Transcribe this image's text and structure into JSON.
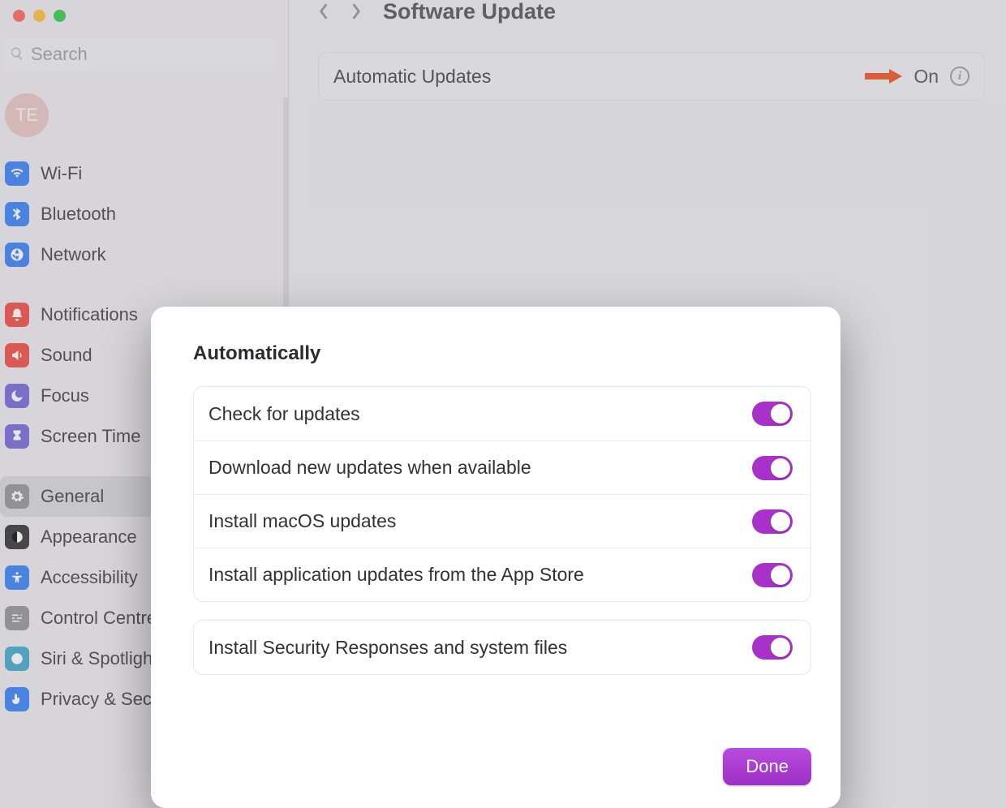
{
  "colors": {
    "accent": "#a832c9",
    "annotation_arrow": "#f24a19"
  },
  "window": {
    "title": "Software Update"
  },
  "search": {
    "placeholder": "Search"
  },
  "user": {
    "initials": "TE"
  },
  "sidebar": {
    "items": [
      {
        "label": "Wi-Fi",
        "color": "#2f7bf6",
        "icon": "wifi"
      },
      {
        "label": "Bluetooth",
        "color": "#2f7bf6",
        "icon": "bluetooth"
      },
      {
        "label": "Network",
        "color": "#2f7bf6",
        "icon": "globe"
      },
      {
        "label": "Notifications",
        "color": "#f2453d",
        "icon": "bell"
      },
      {
        "label": "Sound",
        "color": "#f2453d",
        "icon": "speaker"
      },
      {
        "label": "Focus",
        "color": "#6f62d9",
        "icon": "moon"
      },
      {
        "label": "Screen Time",
        "color": "#6f62d9",
        "icon": "hourglass"
      },
      {
        "label": "General",
        "color": "#8f8f95",
        "icon": "gear"
      },
      {
        "label": "Appearance",
        "color": "#2c2c2f",
        "icon": "appearance"
      },
      {
        "label": "Accessibility",
        "color": "#2f7bf6",
        "icon": "accessibility"
      },
      {
        "label": "Control Centre",
        "color": "#8f8f95",
        "icon": "sliders"
      },
      {
        "label": "Siri & Spotlight",
        "color": "#3aa6c9",
        "icon": "siri"
      },
      {
        "label": "Privacy & Security",
        "color": "#2f7bf6",
        "icon": "hand"
      }
    ],
    "selected_index": 7
  },
  "card": {
    "title": "Automatic Updates",
    "value": "On"
  },
  "modal": {
    "heading": "Automatically",
    "groups": [
      {
        "rows": [
          {
            "label": "Check for updates",
            "on": true
          },
          {
            "label": "Download new updates when available",
            "on": true
          },
          {
            "label": "Install macOS updates",
            "on": true
          },
          {
            "label": "Install application updates from the App Store",
            "on": true
          }
        ]
      },
      {
        "rows": [
          {
            "label": "Install Security Responses and system files",
            "on": true
          }
        ]
      }
    ],
    "done_label": "Done"
  }
}
